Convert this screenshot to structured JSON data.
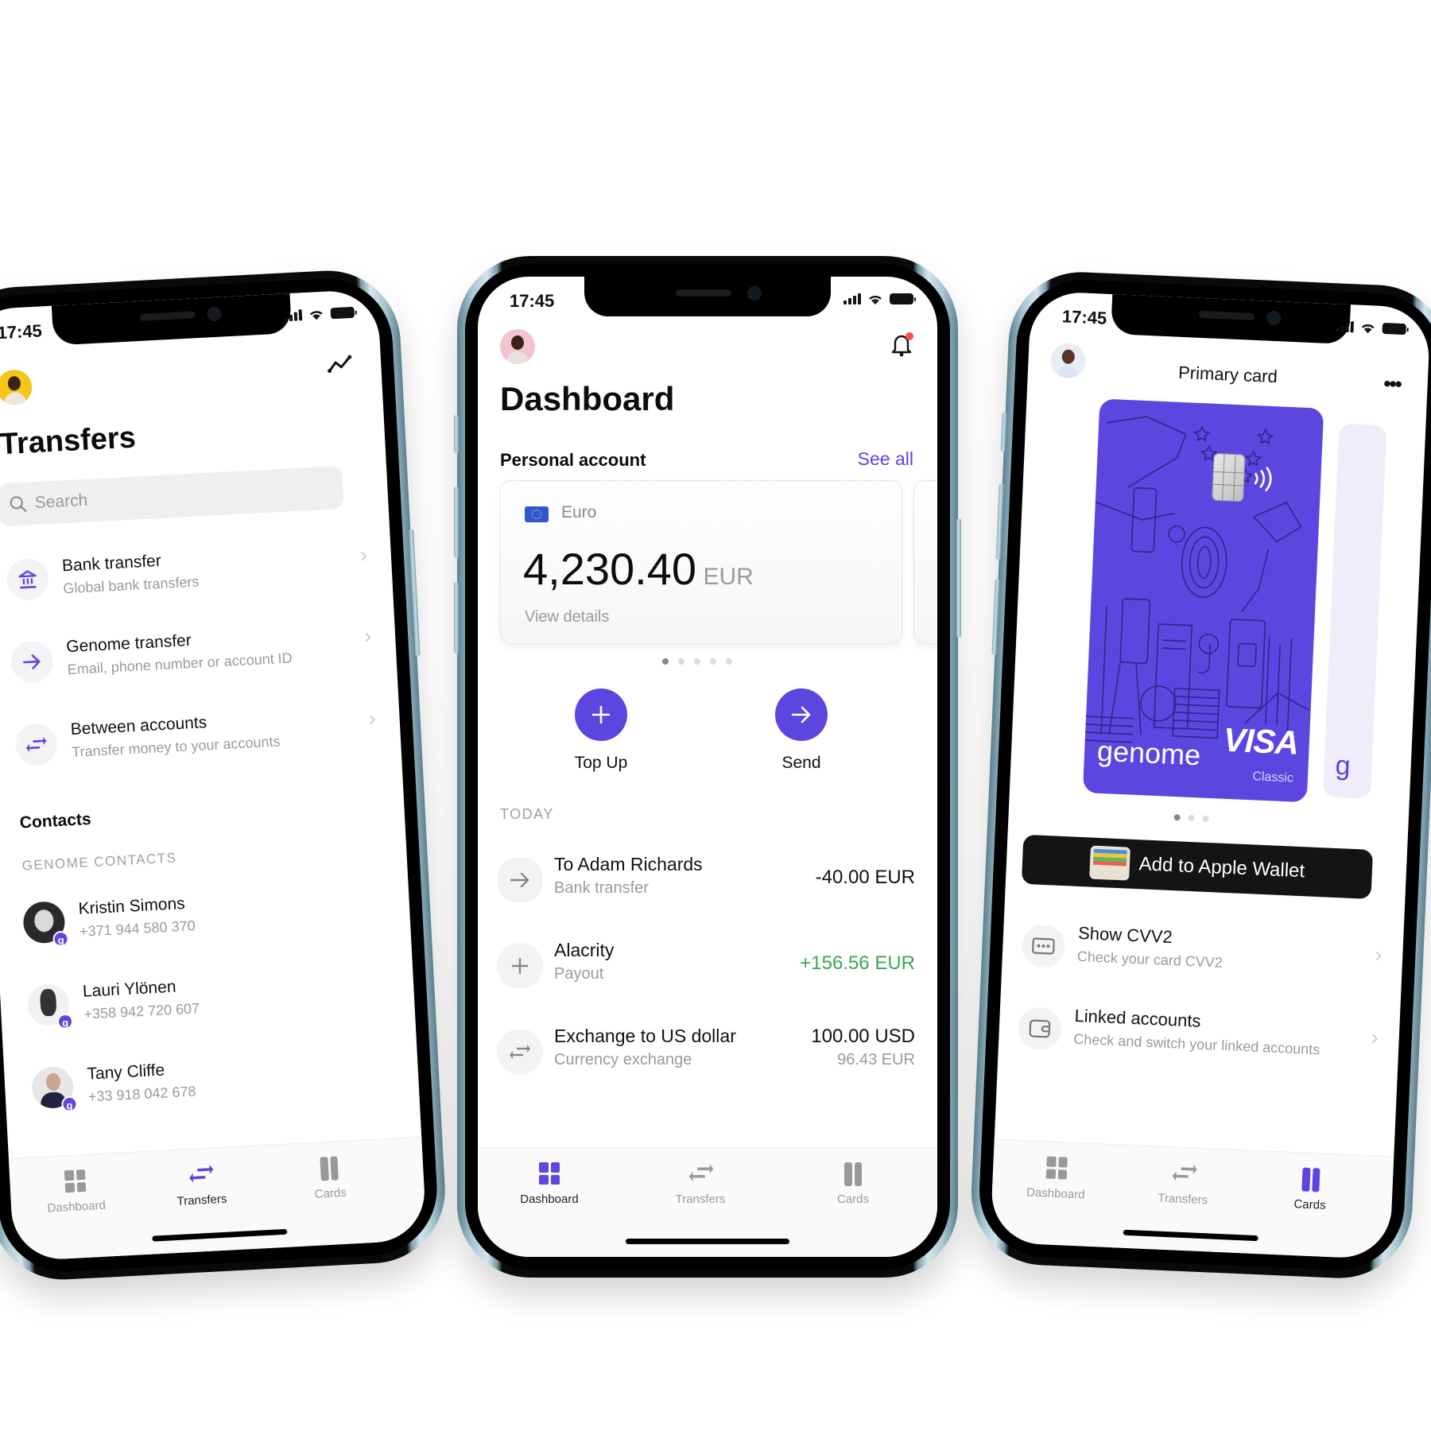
{
  "status_bar": {
    "time": "17:45"
  },
  "colors": {
    "accent": "#5b47e0",
    "positive": "#3aa655",
    "muted": "#9a9a9a",
    "notification": "#ff4d4d"
  },
  "tabbar": {
    "items": [
      {
        "label": "Dashboard",
        "icon": "dashboard-grid-icon"
      },
      {
        "label": "Transfers",
        "icon": "swap-arrows-icon"
      },
      {
        "label": "Cards",
        "icon": "cards-icon"
      }
    ]
  },
  "transfers_screen": {
    "title": "Transfers",
    "header_icon": "analytics-line-icon",
    "search": {
      "placeholder": "Search"
    },
    "options": [
      {
        "title": "Bank transfer",
        "subtitle": "Global bank transfers",
        "icon": "bank-icon"
      },
      {
        "title": "Genome transfer",
        "subtitle": "Email, phone number or account ID",
        "icon": "arrow-right-icon"
      },
      {
        "title": "Between accounts",
        "subtitle": "Transfer money to your accounts",
        "icon": "swap-arrows-icon"
      }
    ],
    "contacts_heading": "Contacts",
    "contacts_section": "GENOME CONTACTS",
    "contacts": [
      {
        "name": "Kristin Simons",
        "phone": "+371 944 580 370",
        "badge": "g"
      },
      {
        "name": "Lauri Ylönen",
        "phone": "+358 942 720 607",
        "badge": "g"
      },
      {
        "name": "Tany Cliffe",
        "phone": "+33 918 042 678",
        "badge": "g"
      }
    ],
    "active_tab": "Transfers"
  },
  "dashboard_screen": {
    "title": "Dashboard",
    "section_title": "Personal account",
    "see_all": "See all",
    "account": {
      "currency_name": "Euro",
      "amount": "4,230.40",
      "currency_code": "EUR",
      "view_details": "View details"
    },
    "carousel": {
      "pages": 5,
      "current": 1
    },
    "actions": [
      {
        "label": "Top Up",
        "icon": "plus-icon"
      },
      {
        "label": "Send",
        "icon": "arrow-right-icon"
      }
    ],
    "today_label": "TODAY",
    "transactions": [
      {
        "title": "To Adam Richards",
        "subtitle": "Bank transfer",
        "amount": "-40.00 EUR",
        "secondary_amount": "",
        "icon": "arrow-right-icon",
        "positive": false
      },
      {
        "title": "Alacrity",
        "subtitle": "Payout",
        "amount": "+156.56 EUR",
        "secondary_amount": "",
        "icon": "plus-icon",
        "positive": true
      },
      {
        "title": "Exchange to US dollar",
        "subtitle": "Currency exchange",
        "amount": "100.00 USD",
        "secondary_amount": "96.43 EUR",
        "icon": "swap-arrows-icon",
        "positive": false
      }
    ],
    "active_tab": "Dashboard"
  },
  "cards_screen": {
    "title": "Primary card",
    "card": {
      "brand": "genome",
      "network": "VISA",
      "tier": "Classic"
    },
    "carousel": {
      "pages": 3,
      "current": 1
    },
    "wallet_button": "Add to Apple Wallet",
    "options": [
      {
        "title": "Show CVV2",
        "subtitle": "Check your card CVV2",
        "icon": "cvv-dots-icon"
      },
      {
        "title": "Linked accounts",
        "subtitle": "Check and switch your linked accounts",
        "icon": "wallet-icon"
      }
    ],
    "active_tab": "Cards"
  }
}
